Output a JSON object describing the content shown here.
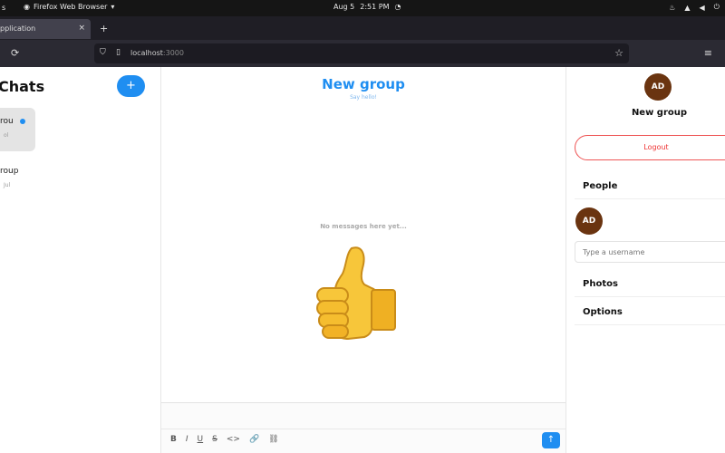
{
  "os_bar": {
    "activities": "s",
    "app_name": "Firefox Web Browser",
    "app_chevron": "▾",
    "date": "Aug 5",
    "time": "2:51 PM",
    "icons": [
      "app-icon",
      "clock-icon",
      "brand-icon",
      "network-icon",
      "volume-icon",
      "power-icon"
    ]
  },
  "browser": {
    "tab_title": "pplication",
    "tab_close": "×",
    "new_tab": "+",
    "reload": "⟳",
    "url": {
      "host": "localhost",
      "path": ":3000"
    },
    "star": "☆",
    "menu": "≡"
  },
  "left": {
    "title": "Chats",
    "add_label": "+",
    "chats": [
      {
        "name": "rou",
        "meta": "ol",
        "unread": true
      },
      {
        "name": "roup",
        "meta": "Jul"
      }
    ]
  },
  "center": {
    "title": "New group",
    "subtitle": "Say hello!",
    "empty_text": "No messages here yet...",
    "toolbar": [
      "B",
      "I",
      "U",
      "S",
      "<>",
      "🔗",
      "⛓"
    ],
    "send_label": "↑"
  },
  "right": {
    "avatar_initials": "AD",
    "group_name": "New group",
    "logout_label": "Logout",
    "people_label": "People",
    "member_initials": "AD",
    "username_placeholder": "Type a username",
    "photos_label": "Photos",
    "options_label": "Options"
  },
  "colors": {
    "accent": "#1f8ef1",
    "avatar": "#6a3410",
    "logout": "#e33333"
  }
}
